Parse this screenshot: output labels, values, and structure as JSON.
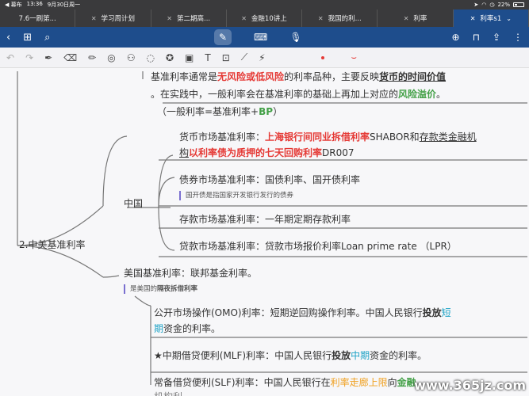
{
  "status": {
    "back_app": "◀ 幕布",
    "time": "13:36",
    "date": "9月30日周一",
    "battery": "22%"
  },
  "tabs": [
    {
      "label": "7.6一刷第..."
    },
    {
      "label": "学习周计划"
    },
    {
      "label": "第二期高..."
    },
    {
      "label": "金融10讲上"
    },
    {
      "label": "我国的利..."
    },
    {
      "label": "利率"
    },
    {
      "label": "利率s1"
    }
  ],
  "note": {
    "p1_a": "基准利率通常是",
    "p1_b": "无风险或低风险",
    "p1_c": "的利率品种，主要反映",
    "p1_d": "货币的时间价值",
    "p2_a": "。在实践中，一般利率会在基准利率的基础上再加上对应的",
    "p2_b": "风险溢价",
    "p2_c": "。",
    "p3_a": "（一般利率=基准利率+",
    "p3_b": "BP",
    "p3_c": "）",
    "money_a": "货币市场基准利率：",
    "money_b": "上海银行间同业拆借利率",
    "money_c": "SHABOR和",
    "money_d": "存款类金融机",
    "money_e": "构",
    "money_f": "以利率债为质押的七天回购利率",
    "money_g": "DR007",
    "bond": "债券市场基准利率：国债利率、国开债利率",
    "bond_note": "国开债是指国家开发银行发行的债券",
    "deposit": "存款市场基准利率：一年期定期存款利率",
    "loan": "贷款市场基准利率：贷款市场报价利率Loan prime rate （LPR）",
    "china": "中国",
    "section": "2.中美基准利率",
    "us": "美国基准利率：联邦基金利率。",
    "us_note_a": "是美国的",
    "us_note_b": "隔夜拆借利率",
    "omo_a": "公开市场操作(OMO)利率：短期逆回购操作利率。中国人民银行",
    "omo_b": "投放",
    "omo_c": "短",
    "omo_d": "期",
    "omo_e": "资金的利率。",
    "mlf_a": "★中期借贷便利(MLF)利率：中国人民银行",
    "mlf_b": "投放",
    "mlf_c": "中期",
    "mlf_d": "资金的利率。",
    "slf_a": "常备借贷便利(SLF)利率：中国人民银行在",
    "slf_b": "利率走廊上限",
    "slf_c": "向",
    "slf_d": "金融",
    "slf_e": "机构",
    "slf_f": "利"
  },
  "watermark": "www.365jz.com",
  "colors": {
    "accent": "#1e4d8c",
    "red": "#e53935",
    "green": "#43a047",
    "cyan": "#1ea3c6",
    "orange": "#f0a020"
  }
}
